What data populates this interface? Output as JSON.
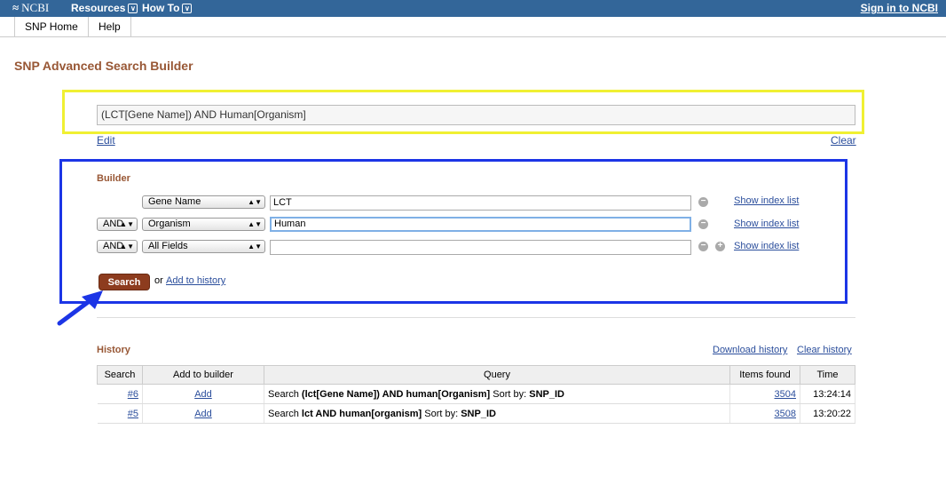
{
  "topbar": {
    "logo": "NCBI",
    "resources": "Resources",
    "howto": "How To",
    "signin": "Sign in to NCBI"
  },
  "subnav": {
    "home": "SNP Home",
    "help": "Help"
  },
  "page_title": "SNP Advanced Search Builder",
  "query": {
    "value": "(LCT[Gene Name]) AND Human[Organism]",
    "edit": "Edit",
    "clear": "Clear"
  },
  "builder": {
    "label": "Builder",
    "rows": [
      {
        "op": "",
        "field": "Gene Name",
        "term": "LCT",
        "show_index": "Show index list"
      },
      {
        "op": "AND",
        "field": "Organism",
        "term": "Human",
        "show_index": "Show index list"
      },
      {
        "op": "AND",
        "field": "All Fields",
        "term": "",
        "show_index": "Show index list"
      }
    ],
    "search_button": "Search",
    "or_text": "or",
    "add_to_history": "Add to history"
  },
  "history": {
    "label": "History",
    "download": "Download history",
    "clear": "Clear history",
    "columns": [
      "Search",
      "Add to builder",
      "Query",
      "Items found",
      "Time"
    ],
    "rows": [
      {
        "search": "#6",
        "add": "Add",
        "prefix": "Search ",
        "query": "(lct[Gene Name]) AND human[Organism]",
        "sort_text": " Sort by: ",
        "sort": "SNP_ID",
        "items": "3504",
        "time": "13:24:14"
      },
      {
        "search": "#5",
        "add": "Add",
        "prefix": "Search ",
        "query": "lct AND human[organism]",
        "sort_text": " Sort by: ",
        "sort": "SNP_ID",
        "items": "3508",
        "time": "13:20:22"
      }
    ]
  },
  "colors": {
    "topbar": "#336699",
    "title": "#985735",
    "highlight_yellow": "#f0f032",
    "highlight_blue": "#1c35e6",
    "search_button": "#8d3c1e"
  }
}
